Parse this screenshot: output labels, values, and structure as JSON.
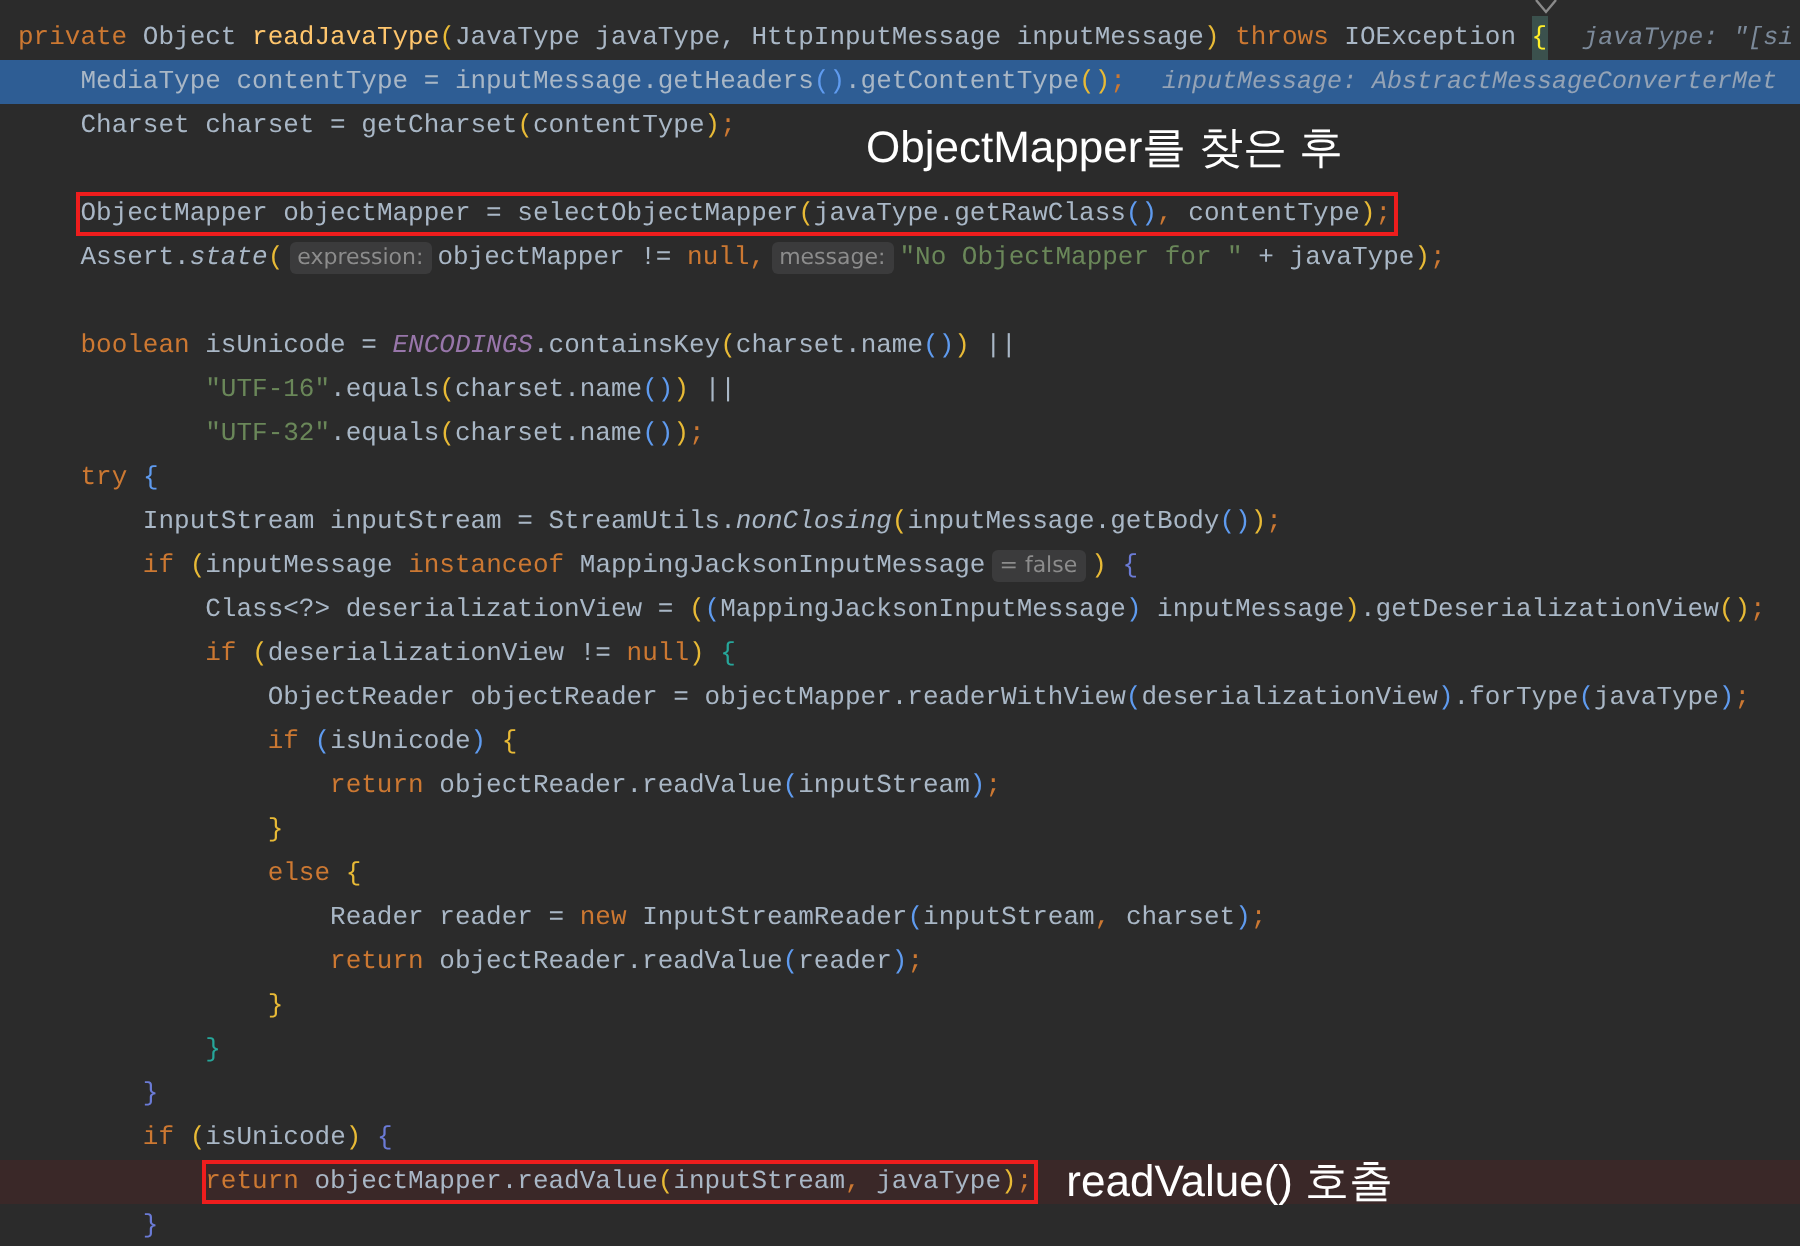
{
  "lines": [
    {
      "tokens": [
        {
          "text": "private",
          "kind": "keyword"
        },
        {
          "text": " Object ",
          "kind": "plain"
        },
        {
          "text": "readJavaType",
          "kind": "decl"
        },
        {
          "text": "(",
          "kind": "bracket",
          "color": "#e8ba36"
        },
        {
          "text": "JavaType javaType, HttpInputMessage inputMessage",
          "kind": "plain"
        },
        {
          "text": ")",
          "kind": "bracket",
          "color": "#e8ba36"
        },
        {
          "text": " throws",
          "kind": "keyword"
        },
        {
          "text": " IOException ",
          "kind": "plain"
        },
        {
          "text": "{",
          "kind": "match"
        },
        {
          "text": "javaType: \"[si",
          "kind": "tail"
        }
      ]
    },
    {
      "selected": true,
      "tokens": [
        {
          "text": "    MediaType contentType = inputMessage.getHeaders",
          "kind": "plain"
        },
        {
          "text": "()",
          "kind": "bracket",
          "color": "#5f9bef"
        },
        {
          "text": ".getContentType",
          "kind": "plain"
        },
        {
          "text": "()",
          "kind": "bracket",
          "color": "#e8ba36"
        },
        {
          "text": ";",
          "kind": "keyword"
        },
        {
          "text": "inputMessage: AbstractMessageConverterMet",
          "kind": "tail"
        }
      ]
    },
    {
      "tokens": [
        {
          "text": "    Charset charset = getCharset",
          "kind": "plain"
        },
        {
          "text": "(",
          "kind": "bracket",
          "color": "#e8ba36"
        },
        {
          "text": "contentType",
          "kind": "plain"
        },
        {
          "text": ")",
          "kind": "bracket",
          "color": "#e8ba36"
        },
        {
          "text": ";",
          "kind": "keyword"
        }
      ]
    },
    {
      "note": "ObjectMapper를 찾은 후"
    },
    {
      "boxed": true,
      "tokens": [
        {
          "text": "    ObjectMapper objectMapper = selectObjectMapper",
          "kind": "plain"
        },
        {
          "text": "(",
          "kind": "bracket",
          "color": "#e8ba36"
        },
        {
          "text": "javaType.getRawClass",
          "kind": "plain"
        },
        {
          "text": "()",
          "kind": "bracket",
          "color": "#5f9bef"
        },
        {
          "text": ",",
          "kind": "keyword"
        },
        {
          "text": " contentType",
          "kind": "plain"
        },
        {
          "text": ")",
          "kind": "bracket",
          "color": "#e8ba36"
        },
        {
          "text": ";",
          "kind": "keyword"
        }
      ]
    },
    {
      "tokens": [
        {
          "text": "    Assert.",
          "kind": "plain"
        },
        {
          "text": "state",
          "kind": "italic"
        },
        {
          "text": "(",
          "kind": "bracket",
          "color": "#e8ba36"
        },
        {
          "text": "expression:",
          "kind": "hint"
        },
        {
          "text": "objectMapper != ",
          "kind": "plain"
        },
        {
          "text": "null",
          "kind": "keyword"
        },
        {
          "text": ",",
          "kind": "keyword"
        },
        {
          "text": "message:",
          "kind": "hint"
        },
        {
          "text": "\"No ObjectMapper for \"",
          "kind": "string"
        },
        {
          "text": " + javaType",
          "kind": "plain"
        },
        {
          "text": ")",
          "kind": "bracket",
          "color": "#e8ba36"
        },
        {
          "text": ";",
          "kind": "keyword"
        }
      ]
    },
    {
      "blank_before": true,
      "tokens": [
        {
          "text": "    boolean",
          "kind": "keyword"
        },
        {
          "text": " isUnicode = ",
          "kind": "plain"
        },
        {
          "text": "ENCODINGS",
          "kind": "constant"
        },
        {
          "text": ".containsKey",
          "kind": "plain"
        },
        {
          "text": "(",
          "kind": "bracket",
          "color": "#e8ba36"
        },
        {
          "text": "charset.name",
          "kind": "plain"
        },
        {
          "text": "()",
          "kind": "bracket",
          "color": "#5f9bef"
        },
        {
          "text": ")",
          "kind": "bracket",
          "color": "#e8ba36"
        },
        {
          "text": " ||",
          "kind": "plain"
        }
      ]
    },
    {
      "tokens": [
        {
          "text": "            \"UTF-16\"",
          "kind": "string"
        },
        {
          "text": ".equals",
          "kind": "plain"
        },
        {
          "text": "(",
          "kind": "bracket",
          "color": "#e8ba36"
        },
        {
          "text": "charset.name",
          "kind": "plain"
        },
        {
          "text": "()",
          "kind": "bracket",
          "color": "#5f9bef"
        },
        {
          "text": ")",
          "kind": "bracket",
          "color": "#e8ba36"
        },
        {
          "text": " ||",
          "kind": "plain"
        }
      ]
    },
    {
      "tokens": [
        {
          "text": "            \"UTF-32\"",
          "kind": "string"
        },
        {
          "text": ".equals",
          "kind": "plain"
        },
        {
          "text": "(",
          "kind": "bracket",
          "color": "#e8ba36"
        },
        {
          "text": "charset.name",
          "kind": "plain"
        },
        {
          "text": "()",
          "kind": "bracket",
          "color": "#5f9bef"
        },
        {
          "text": ")",
          "kind": "bracket",
          "color": "#e8ba36"
        },
        {
          "text": ";",
          "kind": "keyword"
        }
      ]
    },
    {
      "tokens": [
        {
          "text": "    try",
          "kind": "keyword"
        },
        {
          "text": " {",
          "kind": "bracket",
          "color": "#5f9bef"
        }
      ]
    },
    {
      "tokens": [
        {
          "text": "        InputStream inputStream = StreamUtils.",
          "kind": "plain"
        },
        {
          "text": "nonClosing",
          "kind": "italic"
        },
        {
          "text": "(",
          "kind": "bracket",
          "color": "#e8ba36"
        },
        {
          "text": "inputMessage.getBody",
          "kind": "plain"
        },
        {
          "text": "()",
          "kind": "bracket",
          "color": "#5f9bef"
        },
        {
          "text": ")",
          "kind": "bracket",
          "color": "#e8ba36"
        },
        {
          "text": ";",
          "kind": "keyword"
        }
      ]
    },
    {
      "tokens": [
        {
          "text": "        if",
          "kind": "keyword"
        },
        {
          "text": " (",
          "kind": "bracket",
          "color": "#e8ba36"
        },
        {
          "text": "inputMessage ",
          "kind": "plain"
        },
        {
          "text": "instanceof",
          "kind": "keyword"
        },
        {
          "text": " MappingJacksonInputMessage",
          "kind": "plain"
        },
        {
          "text": "= false",
          "kind": "hint"
        },
        {
          "text": ")",
          "kind": "bracket",
          "color": "#e8ba36"
        },
        {
          "text": " {",
          "kind": "bracket",
          "color": "#6b7bd6"
        }
      ]
    },
    {
      "tokens": [
        {
          "text": "            Class<?> deserializationView = ",
          "kind": "plain"
        },
        {
          "text": "(",
          "kind": "bracket",
          "color": "#e8ba36"
        },
        {
          "text": "(",
          "kind": "bracket",
          "color": "#5f9bef"
        },
        {
          "text": "MappingJacksonInputMessage",
          "kind": "plain"
        },
        {
          "text": ")",
          "kind": "bracket",
          "color": "#5f9bef"
        },
        {
          "text": " inputMessage",
          "kind": "plain"
        },
        {
          "text": ")",
          "kind": "bracket",
          "color": "#e8ba36"
        },
        {
          "text": ".getDeserializationView",
          "kind": "plain"
        },
        {
          "text": "()",
          "kind": "bracket",
          "color": "#e8ba36"
        },
        {
          "text": ";",
          "kind": "keyword"
        }
      ]
    },
    {
      "tokens": [
        {
          "text": "            if",
          "kind": "keyword"
        },
        {
          "text": " (",
          "kind": "bracket",
          "color": "#e8ba36"
        },
        {
          "text": "deserializationView != ",
          "kind": "plain"
        },
        {
          "text": "null",
          "kind": "keyword"
        },
        {
          "text": ")",
          "kind": "bracket",
          "color": "#e8ba36"
        },
        {
          "text": " {",
          "kind": "bracket",
          "color": "#26a69a"
        }
      ]
    },
    {
      "tokens": [
        {
          "text": "                ObjectReader objectReader = objectMapper.readerWithView",
          "kind": "plain"
        },
        {
          "text": "(",
          "kind": "bracket",
          "color": "#5f9bef"
        },
        {
          "text": "deserializationView",
          "kind": "plain"
        },
        {
          "text": ")",
          "kind": "bracket",
          "color": "#5f9bef"
        },
        {
          "text": ".forType",
          "kind": "plain"
        },
        {
          "text": "(",
          "kind": "bracket",
          "color": "#5f9bef"
        },
        {
          "text": "javaType",
          "kind": "plain"
        },
        {
          "text": ")",
          "kind": "bracket",
          "color": "#5f9bef"
        },
        {
          "text": ";",
          "kind": "keyword"
        }
      ]
    },
    {
      "tokens": [
        {
          "text": "                if",
          "kind": "keyword"
        },
        {
          "text": " (",
          "kind": "bracket",
          "color": "#5f9bef"
        },
        {
          "text": "isUnicode",
          "kind": "plain"
        },
        {
          "text": ")",
          "kind": "bracket",
          "color": "#5f9bef"
        },
        {
          "text": " {",
          "kind": "bracket",
          "color": "#e8ba36"
        }
      ]
    },
    {
      "tokens": [
        {
          "text": "                    return",
          "kind": "keyword"
        },
        {
          "text": " objectReader.readValue",
          "kind": "plain"
        },
        {
          "text": "(",
          "kind": "bracket",
          "color": "#5f9bef"
        },
        {
          "text": "inputStream",
          "kind": "plain"
        },
        {
          "text": ")",
          "kind": "bracket",
          "color": "#5f9bef"
        },
        {
          "text": ";",
          "kind": "keyword"
        }
      ]
    },
    {
      "tokens": [
        {
          "text": "                }",
          "kind": "bracket",
          "color": "#e8ba36"
        }
      ]
    },
    {
      "tokens": [
        {
          "text": "                else",
          "kind": "keyword"
        },
        {
          "text": " {",
          "kind": "bracket",
          "color": "#e8ba36"
        }
      ]
    },
    {
      "tokens": [
        {
          "text": "                    Reader reader = ",
          "kind": "plain"
        },
        {
          "text": "new",
          "kind": "keyword"
        },
        {
          "text": " InputStreamReader",
          "kind": "plain"
        },
        {
          "text": "(",
          "kind": "bracket",
          "color": "#5f9bef"
        },
        {
          "text": "inputStream",
          "kind": "plain"
        },
        {
          "text": ",",
          "kind": "keyword"
        },
        {
          "text": " charset",
          "kind": "plain"
        },
        {
          "text": ")",
          "kind": "bracket",
          "color": "#5f9bef"
        },
        {
          "text": ";",
          "kind": "keyword"
        }
      ]
    },
    {
      "tokens": [
        {
          "text": "                    return",
          "kind": "keyword"
        },
        {
          "text": " objectReader.readValue",
          "kind": "plain"
        },
        {
          "text": "(",
          "kind": "bracket",
          "color": "#5f9bef"
        },
        {
          "text": "reader",
          "kind": "plain"
        },
        {
          "text": ")",
          "kind": "bracket",
          "color": "#5f9bef"
        },
        {
          "text": ";",
          "kind": "keyword"
        }
      ]
    },
    {
      "tokens": [
        {
          "text": "                }",
          "kind": "bracket",
          "color": "#e8ba36"
        }
      ]
    },
    {
      "tokens": [
        {
          "text": "            }",
          "kind": "bracket",
          "color": "#26a69a"
        }
      ]
    },
    {
      "tokens": [
        {
          "text": "        }",
          "kind": "bracket",
          "color": "#6b7bd6"
        }
      ]
    },
    {
      "tokens": [
        {
          "text": "        if",
          "kind": "keyword"
        },
        {
          "text": " (",
          "kind": "bracket",
          "color": "#e8ba36"
        },
        {
          "text": "isUnicode",
          "kind": "plain"
        },
        {
          "text": ")",
          "kind": "bracket",
          "color": "#e8ba36"
        },
        {
          "text": " {",
          "kind": "bracket",
          "color": "#6b7bd6"
        }
      ]
    },
    {
      "breakpoint": true,
      "boxed": true,
      "note": "readValue() 호출",
      "tokens": [
        {
          "text": "            return",
          "kind": "keyword"
        },
        {
          "text": " objectMapper.readValue",
          "kind": "plain"
        },
        {
          "text": "(",
          "kind": "bracket",
          "color": "#e8ba36"
        },
        {
          "text": "inputStream",
          "kind": "plain"
        },
        {
          "text": ",",
          "kind": "keyword"
        },
        {
          "text": " javaType",
          "kind": "plain"
        },
        {
          "text": ")",
          "kind": "bracket",
          "color": "#e8ba36"
        },
        {
          "text": ";",
          "kind": "keyword"
        }
      ]
    },
    {
      "tokens": [
        {
          "text": "        }",
          "kind": "bracket",
          "color": "#6b7bd6"
        }
      ]
    }
  ]
}
